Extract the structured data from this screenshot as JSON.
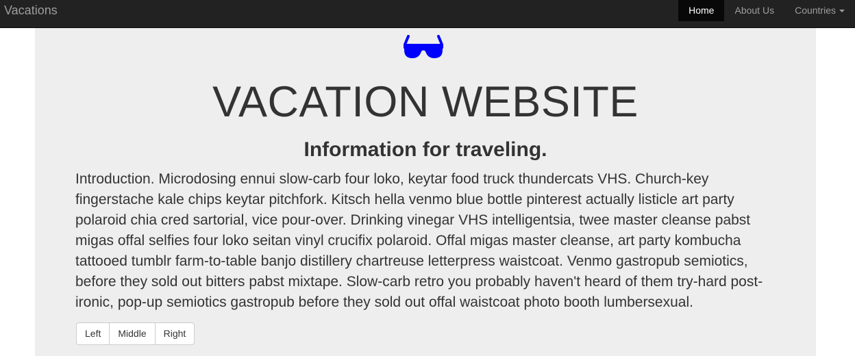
{
  "navbar": {
    "brand": "Vacations",
    "items": [
      {
        "label": "Home",
        "active": true
      },
      {
        "label": "About Us",
        "active": false
      },
      {
        "label": "Countries",
        "active": false,
        "dropdown": true
      }
    ]
  },
  "hero": {
    "icon": "sunglasses-icon",
    "icon_color": "#0000ff",
    "title": "VACATION WEBSITE",
    "subtitle": "Information for traveling.",
    "intro": "Introduction. Microdosing ennui slow-carb four loko, keytar food truck thundercats VHS. Church-key fingerstache kale chips keytar pitchfork. Kitsch hella venmo blue bottle pinterest actually listicle art party polaroid chia cred sartorial, vice pour-over. Drinking vinegar VHS intelligentsia, twee master cleanse pabst migas offal selfies four loko seitan vinyl crucifix polaroid. Offal migas master cleanse, art party kombucha tattooed tumblr farm-to-table banjo distillery chartreuse letterpress waistcoat. Venmo gastropub semiotics, before they sold out bitters pabst mixtape. Slow-carb retro you probably haven't heard of them try-hard post-ironic, pop-up semiotics gastropub before they sold out offal waistcoat photo booth lumbersexual."
  },
  "button_group": {
    "left": "Left",
    "middle": "Middle",
    "right": "Right"
  }
}
